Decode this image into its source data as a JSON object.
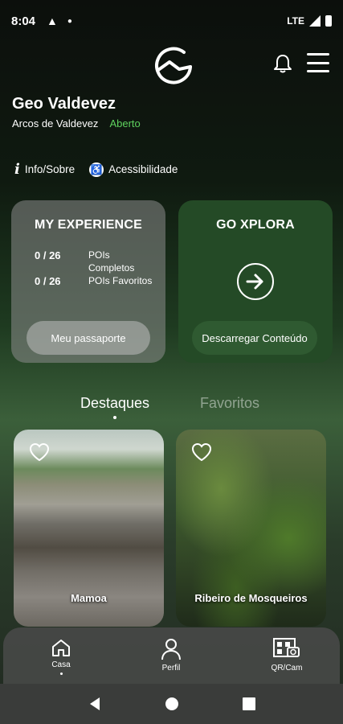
{
  "status_bar": {
    "time": "8:04",
    "network": "LTE"
  },
  "header": {
    "title": "Geo Valdevez",
    "location": "Arcos de Valdevez",
    "status": "Aberto"
  },
  "links": {
    "info": "Info/Sobre",
    "accessibility": "Acessibilidade",
    "info_glyph": "i",
    "acc_glyph": "♿"
  },
  "my_experience": {
    "title": "MY EXPERIENCE",
    "completed_count": "0 / 26",
    "completed_label": "POIs Completos",
    "favorites_count": "0 / 26",
    "favorites_label": "POIs Favoritos",
    "button": "Meu passaporte"
  },
  "go_xplora": {
    "title": "GO XPLORA",
    "button": "Descarregar Conteúdo"
  },
  "tabs": [
    {
      "label": "Destaques",
      "active": true
    },
    {
      "label": "Favoritos",
      "active": false
    }
  ],
  "pois": [
    {
      "name": "Mamoa",
      "icon": "heart-outline-icon"
    },
    {
      "name": "Ribeiro de Mosqueiros",
      "icon": "heart-outline-icon"
    }
  ],
  "bottom_nav": [
    {
      "label": "Casa",
      "icon": "home-icon",
      "active": true
    },
    {
      "label": "Perfil",
      "icon": "person-icon",
      "active": false
    },
    {
      "label": "QR/Cam",
      "icon": "qr-camera-icon",
      "active": false
    }
  ],
  "colors": {
    "status_open": "#5ed15e",
    "go_xplora_bg": "#244a26"
  }
}
